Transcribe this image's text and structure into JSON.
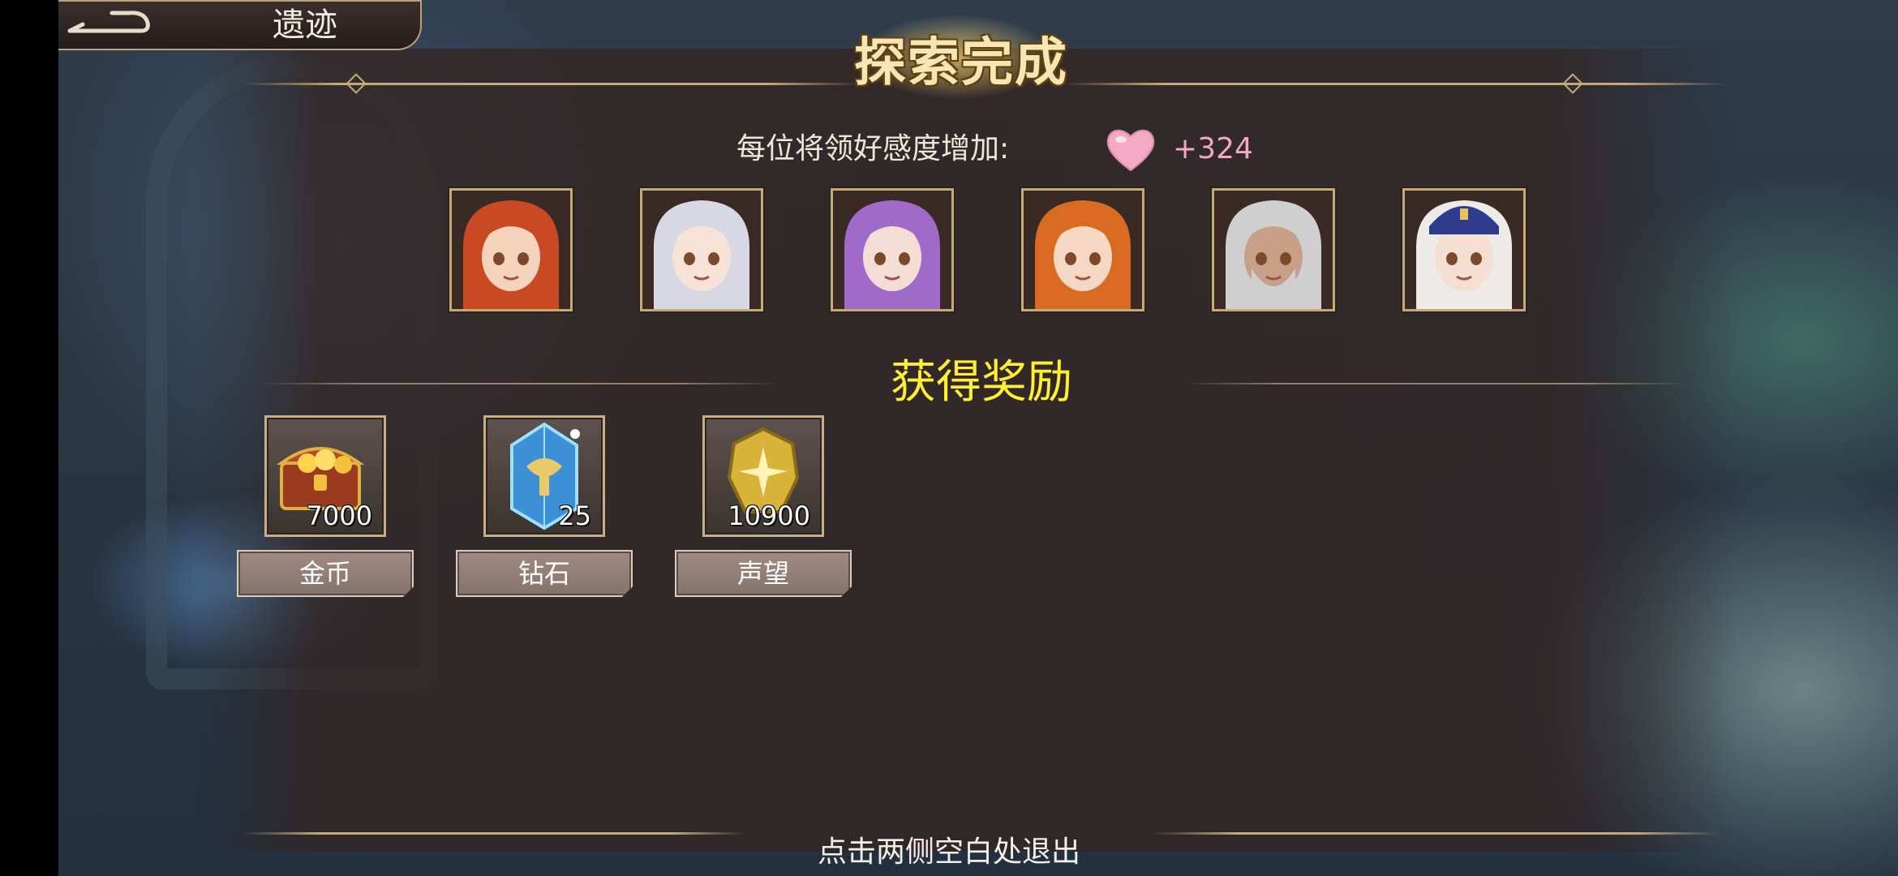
{
  "header": {
    "title": "遗迹",
    "back_icon": "back-arrow-icon"
  },
  "banner": {
    "title": "探索完成"
  },
  "affection": {
    "label": "每位将领好感度增加:",
    "icon": "heart-icon",
    "value": "+324"
  },
  "characters": [
    {
      "name": "character-portrait-red-hair",
      "hair": "#c94a22",
      "skin": "#f3d3bb"
    },
    {
      "name": "character-portrait-silver-hair",
      "hair": "#d8d8e4",
      "skin": "#f6e2d6"
    },
    {
      "name": "character-portrait-purple-hair",
      "hair": "#a06ac8",
      "skin": "#f4ddd4"
    },
    {
      "name": "character-portrait-orange-hair",
      "hair": "#d86a22",
      "skin": "#f5d8c4"
    },
    {
      "name": "character-portrait-grey-beard",
      "hair": "#cfcfcf",
      "skin": "#c8a088"
    },
    {
      "name": "character-portrait-white-hair-cap",
      "hair": "#eeeae8",
      "skin": "#f5ded2"
    }
  ],
  "rewards": {
    "title": "获得奖励",
    "items": [
      {
        "label": "金币",
        "quantity": "7000",
        "icon": "treasure-chest-icon"
      },
      {
        "label": "钻石",
        "quantity": "25",
        "icon": "diamond-crystal-icon"
      },
      {
        "label": "声望",
        "quantity": "10900",
        "icon": "prestige-medal-icon"
      }
    ]
  },
  "footer": {
    "hint": "点击两侧空白处退出"
  }
}
